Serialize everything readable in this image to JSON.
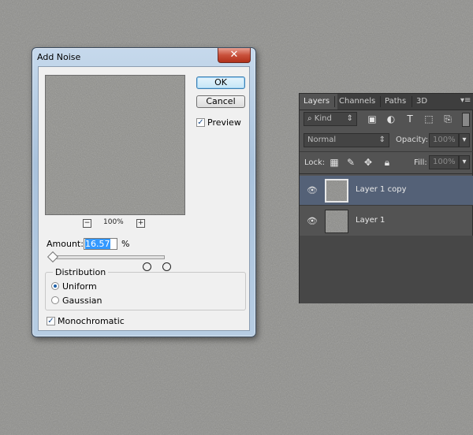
{
  "dialog": {
    "title": "Add Noise",
    "close_glyph": "✕",
    "ok_label": "OK",
    "cancel_label": "Cancel",
    "preview_label": "Preview",
    "preview_checked": true,
    "zoom_minus": "−",
    "zoom_plus": "+",
    "zoom_level": "100%",
    "amount_label": "Amount:",
    "amount_value": "16.57",
    "amount_unit": "%",
    "distribution_label": "Distribution",
    "uniform_label": "Uniform",
    "gaussian_label": "Gaussian",
    "selected_distribution": "Uniform",
    "monochromatic_label": "Monochromatic",
    "monochromatic_checked": true
  },
  "layers_panel": {
    "tabs": [
      "Layers",
      "Channels",
      "Paths",
      "3D"
    ],
    "active_tab": "Layers",
    "menu_glyph": "▾≡",
    "filter_kind": "Kind",
    "filter_icons": [
      "image-filter-icon",
      "adjustment-filter-icon",
      "type-filter-icon",
      "shape-filter-icon",
      "smart-object-filter-icon"
    ],
    "blend_mode": "Normal",
    "opacity_label": "Opacity:",
    "opacity_value": "100%",
    "lock_label": "Lock:",
    "fill_label": "Fill:",
    "fill_value": "100%",
    "layers": [
      {
        "name": "Layer 1 copy",
        "selected": true
      },
      {
        "name": "Layer 1",
        "selected": false
      }
    ]
  },
  "colors": {
    "canvas_gray": "#8f8f8c",
    "panel_bg": "#535353",
    "selected_layer": "#546177",
    "dialog_frame": "#b7cde3"
  }
}
